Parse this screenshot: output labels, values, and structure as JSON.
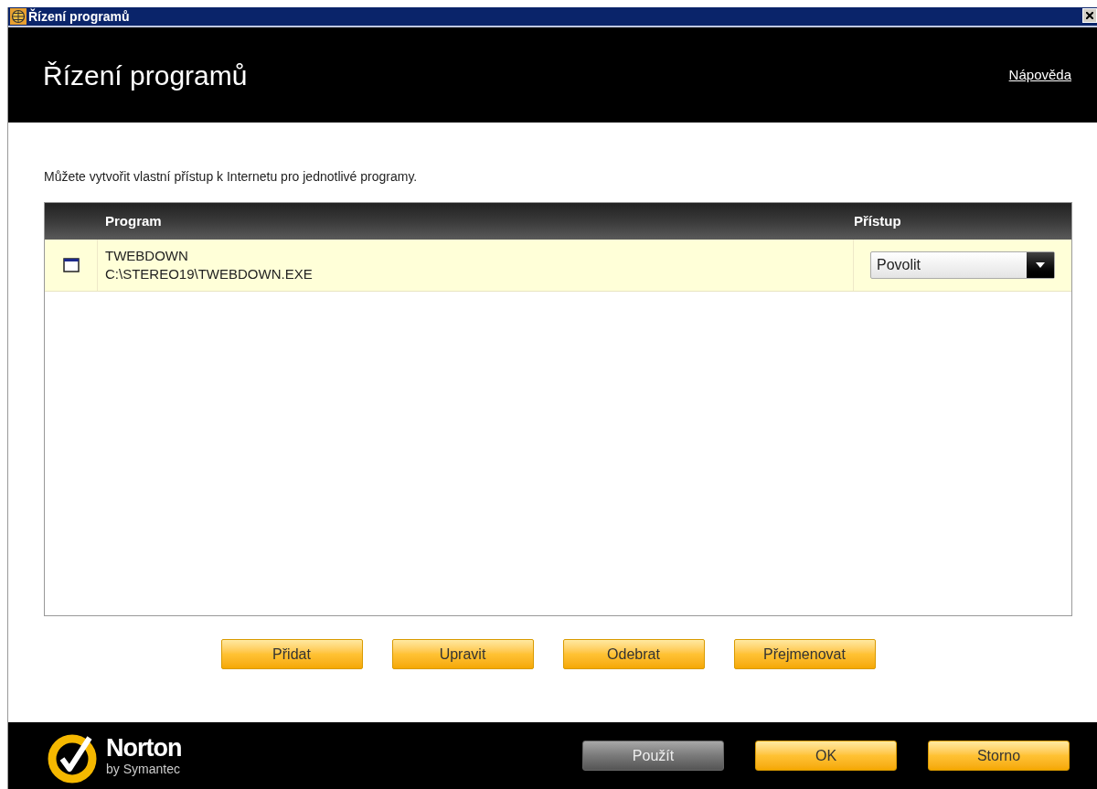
{
  "window": {
    "title": "Řízení programů"
  },
  "header": {
    "title": "Řízení programů",
    "help_link": "Nápověda"
  },
  "intro": "Můžete vytvořit vlastní přístup k Internetu pro jednotlivé programy.",
  "table": {
    "columns": [
      "Program",
      "Přístup"
    ],
    "rows": [
      {
        "name": "TWEBDOWN",
        "path": "C:\\STEREO19\\TWEBDOWN.EXE",
        "access": "Povolit",
        "selected": true
      }
    ]
  },
  "actions": [
    "Přidat",
    "Upravit",
    "Odebrat",
    "Přejmenovat"
  ],
  "footer": {
    "brand": "Norton",
    "brand_sub": "by Symantec",
    "buttons": [
      {
        "label": "Použít",
        "disabled": true
      },
      {
        "label": "OK",
        "disabled": false
      },
      {
        "label": "Storno",
        "disabled": false
      }
    ]
  }
}
